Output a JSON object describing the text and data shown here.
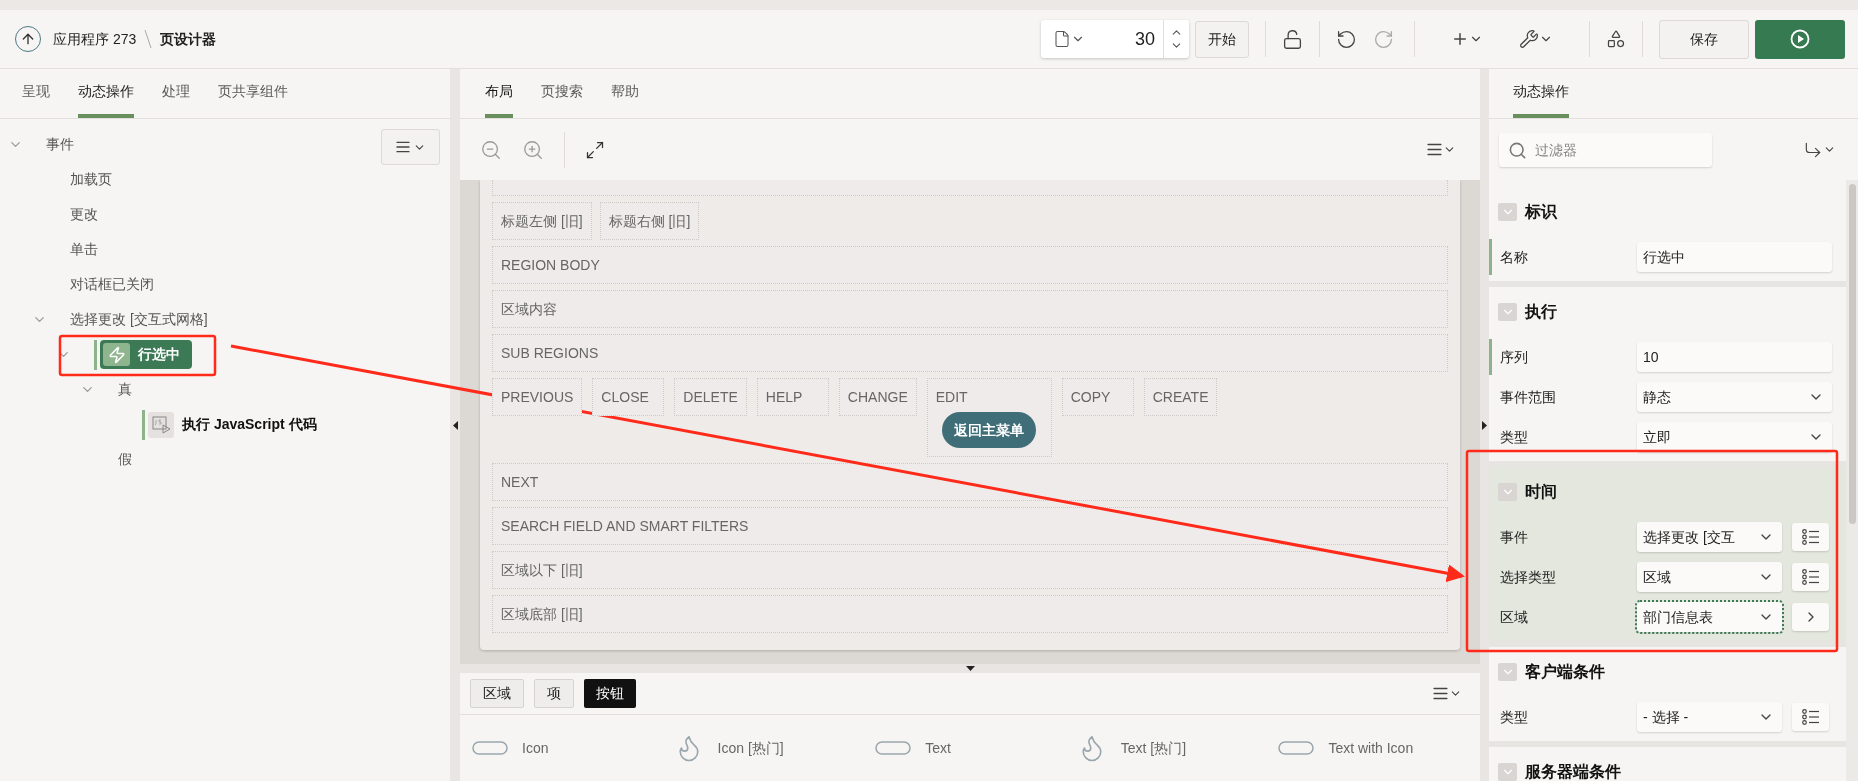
{
  "header": {
    "breadcrumb": [
      {
        "label": "应用程序 273"
      },
      {
        "label": "页设计器"
      }
    ],
    "page_number": "30",
    "start_button": "开始",
    "save_button": "保存"
  },
  "left_panel": {
    "tabs": [
      {
        "label": "呈现",
        "selected": false
      },
      {
        "label": "动态操作",
        "selected": true
      },
      {
        "label": "处理",
        "selected": false
      },
      {
        "label": "页共享组件",
        "selected": false
      }
    ],
    "tree": [
      {
        "label": "事件",
        "selected": false,
        "expanded": true,
        "children": [
          {
            "label": "加载页",
            "selected": false
          },
          {
            "label": "更改",
            "selected": false
          },
          {
            "label": "单击",
            "selected": false
          },
          {
            "label": "对话框已关闭",
            "selected": false
          },
          {
            "label": "选择更改 [交互式网格]",
            "selected": false,
            "expanded": true,
            "children": [
              {
                "label": "行选中",
                "kind": "dynamic_action",
                "selected": true,
                "expanded": true,
                "children": [
                  {
                    "label": "真",
                    "selected": false,
                    "expanded": true,
                    "children": [
                      {
                        "label": "执行 JavaScript 代码",
                        "kind": "action",
                        "selected": false
                      }
                    ]
                  },
                  {
                    "label": "假",
                    "selected": false
                  }
                ]
              }
            ]
          }
        ]
      }
    ]
  },
  "center_panel": {
    "tabs": [
      {
        "label": "布局",
        "selected": true
      },
      {
        "label": "页搜索",
        "selected": false
      },
      {
        "label": "帮助",
        "selected": false
      }
    ],
    "layout_rows": [
      {
        "kind": "group",
        "items": [
          {
            "label": "标题左侧 [旧]"
          },
          {
            "label": "标题右侧 [旧]"
          }
        ]
      },
      {
        "kind": "row",
        "label": "REGION BODY"
      },
      {
        "kind": "row",
        "label": "区域内容"
      },
      {
        "kind": "row",
        "label": "SUB REGIONS"
      },
      {
        "kind": "buttons",
        "items": [
          {
            "label": "PREVIOUS"
          },
          {
            "label": "CLOSE"
          },
          {
            "label": "DELETE"
          },
          {
            "label": "HELP"
          },
          {
            "label": "CHANGE"
          },
          {
            "label": "EDIT",
            "button": "返回主菜单"
          },
          {
            "label": "COPY"
          },
          {
            "label": "CREATE"
          }
        ]
      },
      {
        "kind": "row",
        "label": "NEXT"
      },
      {
        "kind": "row",
        "label": "SEARCH FIELD AND SMART FILTERS"
      },
      {
        "kind": "row",
        "label": "区域以下 [旧]"
      },
      {
        "kind": "row",
        "label": "区域底部 [旧]"
      }
    ],
    "gallery": {
      "tabs": [
        {
          "label": "区域",
          "selected": false
        },
        {
          "label": "项",
          "selected": false
        },
        {
          "label": "按钮",
          "selected": true
        }
      ],
      "items": [
        {
          "label": "Icon",
          "kind": "pill"
        },
        {
          "label": "Icon [热门]",
          "kind": "flame"
        },
        {
          "label": "Text",
          "kind": "pill"
        },
        {
          "label": "Text [热门]",
          "kind": "flame"
        },
        {
          "label": "Text with Icon",
          "kind": "pill"
        }
      ]
    }
  },
  "right_panel": {
    "tabs": [
      {
        "label": "动态操作",
        "selected": true
      }
    ],
    "filter": {
      "placeholder": "过滤器"
    },
    "sections": [
      {
        "title": "标识",
        "highlighted": false,
        "fields": [
          {
            "label": "名称",
            "value": "行选中",
            "kind": "text",
            "required": true
          }
        ]
      },
      {
        "title": "执行",
        "highlighted": false,
        "fields": [
          {
            "label": "序列",
            "value": "10",
            "kind": "text",
            "required": true
          },
          {
            "label": "事件范围",
            "value": "静态",
            "kind": "select",
            "required": false
          },
          {
            "label": "类型",
            "value": "立即",
            "kind": "select",
            "required": false
          }
        ]
      },
      {
        "title": "时间",
        "highlighted": true,
        "fields": [
          {
            "label": "事件",
            "value": "选择更改 [交互",
            "kind": "select",
            "required": false,
            "button": {
              "kind": "list"
            }
          },
          {
            "label": "选择类型",
            "value": "区域",
            "kind": "select",
            "required": false,
            "button": {
              "kind": "list"
            }
          },
          {
            "label": "区域",
            "value": "部门信息表",
            "kind": "select",
            "required": false,
            "focused": true,
            "button": {
              "kind": "link"
            }
          }
        ]
      },
      {
        "title": "客户端条件",
        "highlighted": false,
        "fields": [
          {
            "label": "类型",
            "value": "- 选择 -",
            "kind": "select",
            "required": false,
            "button": {
              "kind": "list"
            }
          }
        ]
      },
      {
        "title": "服务器端条件",
        "highlighted": false
      }
    ]
  }
}
